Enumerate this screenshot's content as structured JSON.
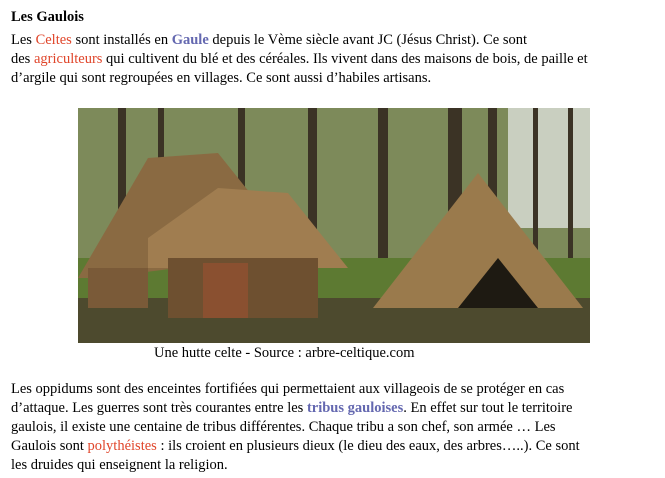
{
  "title": "Les Gaulois",
  "para1": {
    "l1a": "Les ",
    "celtes": "Celtes",
    "l1b": " sont installés en ",
    "gaule": "Gaule",
    "l1c": " depuis le Vème siècle avant JC (Jésus Christ). Ce sont",
    "l2a": "des ",
    "agriculteurs": "agriculteurs",
    "l2b": " qui cultivent du blé et des céréales. Ils vivent dans des maisons de bois, de paille et",
    "l3": "d’argile qui sont regroupées en villages. Ce sont aussi d’habiles artisans."
  },
  "image": {
    "caption": "Une hutte celte - Source : arbre-celtique.com"
  },
  "para2": {
    "l1": "Les oppidums sont des enceintes fortifiées qui permettaient aux villageois de se protéger en cas",
    "l2a": "d’attaque. Les guerres sont très courantes entre les ",
    "tribus": "tribus gauloises",
    "l2b": ". En effet sur tout le territoire",
    "l3": "gaulois, il existe une centaine de tribus différentes. Chaque tribu a son chef, son armée … Les",
    "l4a": "Gaulois sont ",
    "poly": "polythéistes",
    "l4b": " : ils croient en plusieurs dieux (le dieu des eaux, des arbres…..). Ce sont",
    "l5": "les druides qui enseignent la religion."
  },
  "colors": {
    "highlight_red": "#e0452a",
    "highlight_blue": "#6468b0"
  }
}
